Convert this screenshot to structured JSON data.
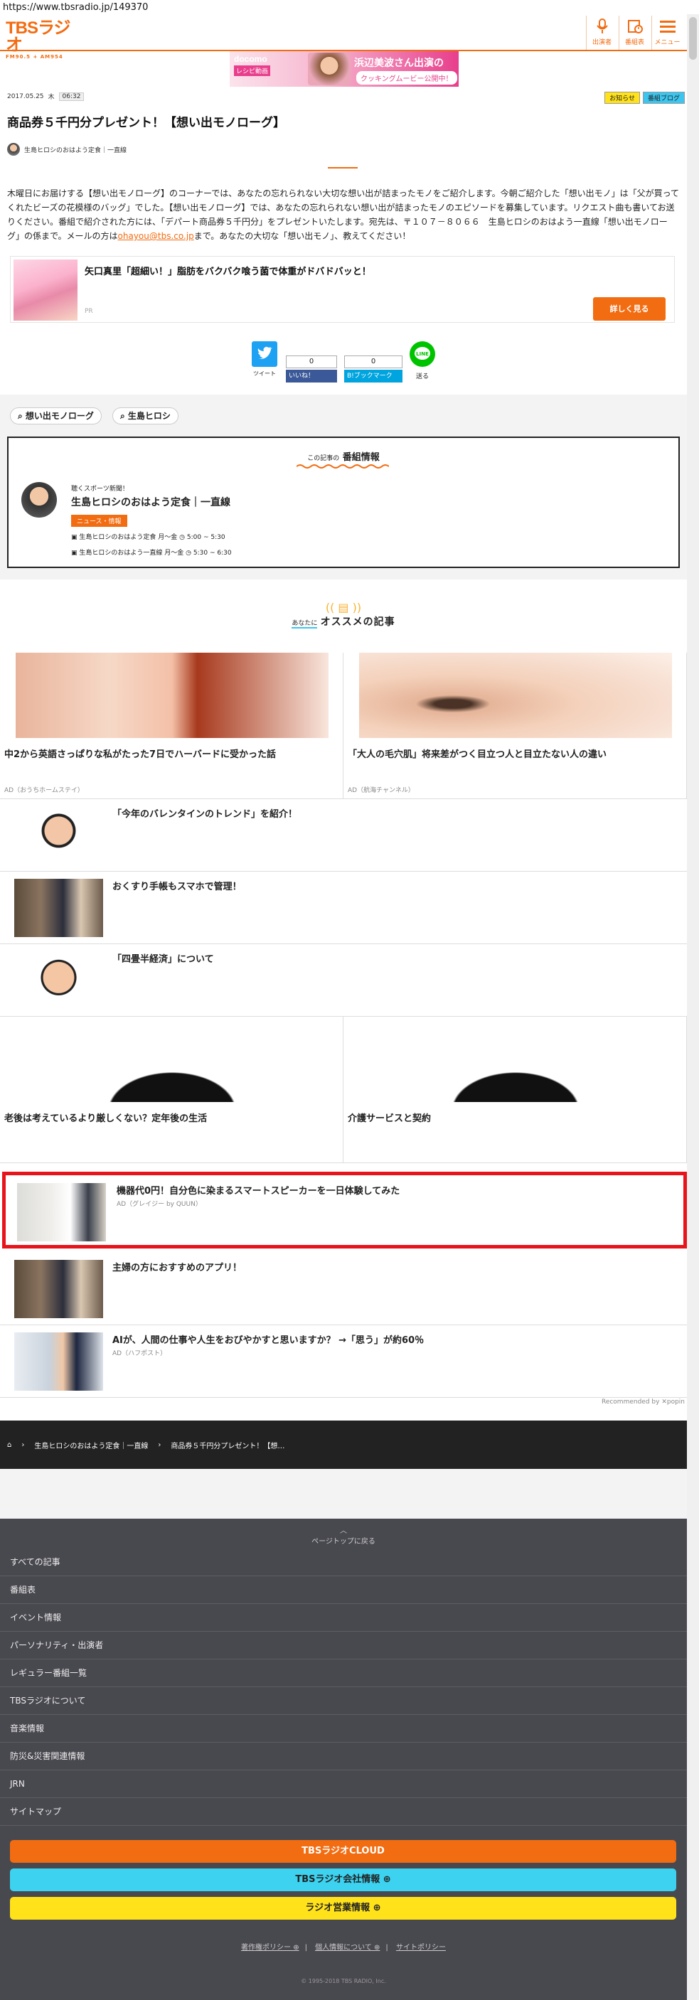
{
  "url": "https://www.tbsradio.jp/149370",
  "header": {
    "logo_main": "TBSラジオ",
    "logo_sub": "FM90.5 + AM954",
    "buttons": [
      {
        "label": "出演者",
        "icon": "microphone-icon"
      },
      {
        "label": "番組表",
        "icon": "schedule-icon"
      },
      {
        "label": "メニュー",
        "icon": "menu-icon"
      }
    ]
  },
  "banner": {
    "brand": "docomo",
    "tag": "レシピ動画",
    "headline": "浜辺美波さん出演の",
    "cta": "クッキングムービー公開中！"
  },
  "article": {
    "date": "2017.05.25",
    "weekday": "木",
    "time": "06:32",
    "tags": [
      "お知らせ",
      "番組ブログ"
    ],
    "title": "商品券５千円分プレゼント！【想い出モノローグ】",
    "program": "生島ヒロシのおはよう定食｜一直線",
    "body_part1": "木曜日にお届けする【想い出モノローグ】のコーナーでは、あなたの忘れられない大切な想い出が詰まったモノをご紹介します。今朝ご紹介した「想い出モノ」は「父が買ってくれたビーズの花模様のバッグ」でした。【想い出モノローグ】では、あなたの忘れられない想い出が詰まったモノのエピソードを募集しています。リクエスト曲も書いてお送りください。番組で紹介された方には、「デパート商品券５千円分」をプレゼントいたします。宛先は、〒１０７－８０６６　生島ヒロシのおはよう一直線「想い出モノローグ」の係まで。メールの方は",
    "email": "ohayou@tbs.co.jp",
    "body_part2": "まで。あなたの大切な「想い出モノ」、教えてください！"
  },
  "related": {
    "title": "矢口真里「超細い！」脂肪をバクバク喰う菌で体重がドバドバッと！",
    "sponsor": "PR",
    "button": "詳しく見る"
  },
  "share": {
    "tweet": "ツイート",
    "like_count": "0",
    "like_label": "いいね！",
    "hatena_count": "0",
    "hatena_label": "B!ブックマーク",
    "line_label": "送る"
  },
  "keywords": [
    "想い出モノローグ",
    "生島ヒロシ"
  ],
  "program_info": {
    "heading_pre": "この記事の",
    "heading": "番組情報",
    "tagline": "聴くスポーツ新聞！",
    "name": "生島ヒロシのおはよう定食｜一直線",
    "category": "ニュース・情報",
    "schedules": [
      {
        "prog": "生島ヒロシのおはよう定食 月～金",
        "time": "5:00 ~ 5:30"
      },
      {
        "prog": "生島ヒロシのおはよう一直線 月～金",
        "time": "5:30 ~ 6:30"
      }
    ]
  },
  "recommend": {
    "pre": "あなたに",
    "heading": "オススメの記事",
    "cards": [
      {
        "title": "中2から英語さっぱりな私がたった7日でハーバードに受かった話",
        "ad": "AD（おうちホームステイ）"
      },
      {
        "title": "「大人の毛穴肌」将来差がつく目立つ人と目立たない人の違い",
        "ad": "AD（航海チャンネル）"
      }
    ],
    "rows": [
      {
        "title": "「今年のバレンタインのトレンド」を紹介！",
        "ad": ""
      },
      {
        "title": "おくすり手帳もスマホで管理！",
        "ad": ""
      },
      {
        "title": "「四畳半経済」について",
        "ad": ""
      }
    ],
    "cards2": [
      {
        "title": "老後は考えているより厳しくない？定年後の生活",
        "ad": ""
      },
      {
        "title": "介護サービスと契約",
        "ad": ""
      }
    ],
    "rows2": [
      {
        "title": "機器代0円！自分色に染まるスマートスピーカーを一日体験してみた",
        "ad": "AD（グレイジー by QUUN）"
      },
      {
        "title": "主婦の方におすすめのアプリ！",
        "ad": ""
      },
      {
        "title": "AIが、人間の仕事や人生をおびやかすと思いますか？ →「思う」が約60％",
        "ad": "AD（ハフポスト）"
      }
    ],
    "recommended_by": "Recommended by",
    "popin": "popin"
  },
  "breadcrumb": [
    "生島ヒロシのおはよう定食｜一直線",
    "商品券５千円分プレゼント！【想…"
  ],
  "footer": {
    "page_top": "ページトップに戻る",
    "menu": [
      "すべての記事",
      "番組表",
      "イベント情報",
      "パーソナリティ・出演者",
      "レギュラー番組一覧",
      "TBSラジオについて",
      "音楽情報",
      "防災&災害関連情報",
      "JRN",
      "サイトマップ"
    ],
    "buttons": [
      {
        "label": "TBSラジオCLOUD",
        "color": "#f26c11"
      },
      {
        "label": "TBSラジオ会社情報 ⊕",
        "color": "#3cd2f0"
      },
      {
        "label": "ラジオ営業情報 ⊕",
        "color": "#ffe21a"
      }
    ],
    "links": [
      "著作権ポリシー ⊕",
      "個人情報について ⊕",
      "サイトポリシー"
    ],
    "copyright": "© 1995-2018 TBS RADIO, Inc."
  }
}
